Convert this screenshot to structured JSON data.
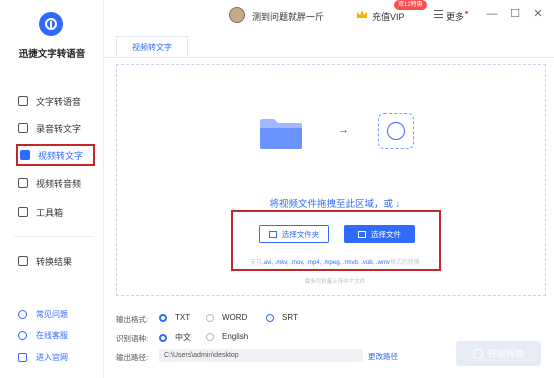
{
  "app": {
    "name": "迅捷文字转语音",
    "logo_icon": "app-logo-icon"
  },
  "sidebar": {
    "items": [
      {
        "label": "文字转语音",
        "icon": "text-to-speech-icon"
      },
      {
        "label": "录音转文字",
        "icon": "recording-to-text-icon"
      },
      {
        "label": "视频转文字",
        "icon": "video-to-text-icon",
        "active": true
      },
      {
        "label": "视频转音频",
        "icon": "video-to-audio-icon"
      },
      {
        "label": "工具箱",
        "icon": "toolbox-icon"
      },
      {
        "label": "转换结果",
        "icon": "results-icon"
      }
    ],
    "bottom": [
      {
        "label": "常见问题",
        "icon": "faq-icon"
      },
      {
        "label": "在线客服",
        "icon": "support-icon"
      },
      {
        "label": "进入官网",
        "icon": "website-icon"
      }
    ]
  },
  "topbar": {
    "user_name": "测到问题就胖一斤",
    "vip_label": "充值VIP",
    "vip_badge": "双12特惠",
    "more_label": "更多",
    "minimize": "—",
    "maximize": "☐",
    "close": "✕"
  },
  "tabs": [
    {
      "label": "视频转文字",
      "active": true
    }
  ],
  "drop_area": {
    "hint": "将视频文件拖拽至此区域，或 ↓",
    "arrow": "→",
    "select_folder_label": "选择文件夹",
    "select_file_label": "选择文件",
    "formats_prefix": "支持",
    "formats": ".avi, .mkv, .mov, .mp4, .mpeg, .rmvb, .vob, .wmv",
    "formats_suffix": "格式的转换",
    "max_size": "最多可批量上传中个文件"
  },
  "options": {
    "output_format_label": "输出格式:",
    "formats": [
      "TXT",
      "WORD",
      "SRT"
    ],
    "selected_format": "TXT",
    "language_label": "识别语种:",
    "languages": [
      "中文",
      "English"
    ],
    "selected_language": "中文",
    "output_path_label": "输出路径:",
    "output_path": "C:\\Users\\admin\\desktop",
    "change_path_label": "更改路径"
  },
  "start_button_label": "开始转换",
  "colors": {
    "accent": "#2f6bff",
    "highlight": "#c0282b",
    "badge": "#ff4d4f"
  }
}
